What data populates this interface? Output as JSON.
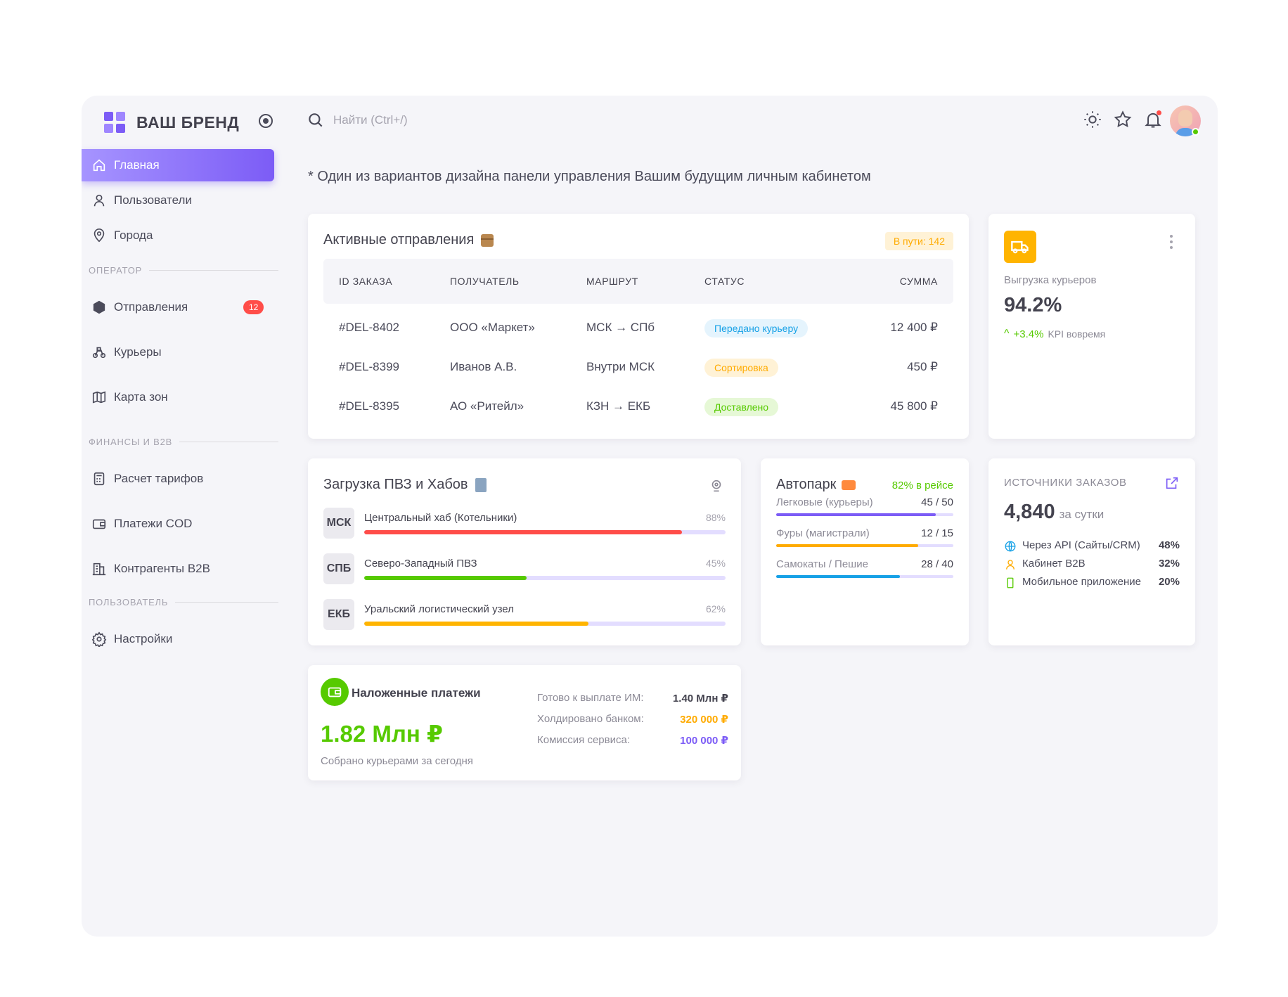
{
  "brand": {
    "name": "ВАШ БРЕНД"
  },
  "sidebar": {
    "items": [
      {
        "label": "Главная",
        "icon": "home-icon"
      },
      {
        "label": "Пользователи",
        "icon": "user-icon"
      },
      {
        "label": "Города",
        "icon": "location-icon"
      }
    ],
    "section_operator": "ОПЕРАТОР",
    "operator_items": [
      {
        "label": "Отправления",
        "icon": "box-icon",
        "badge": "12"
      },
      {
        "label": "Курьеры",
        "icon": "bike-icon"
      },
      {
        "label": "Карта зон",
        "icon": "map-icon"
      }
    ],
    "section_finance": "ФИНАНСЫ И B2B",
    "finance_items": [
      {
        "label": "Расчет тарифов",
        "icon": "calculator-icon"
      },
      {
        "label": "Платежи COD",
        "icon": "wallet-icon"
      },
      {
        "label": "Контрагенты B2B",
        "icon": "building-icon"
      }
    ],
    "section_user": "ПОЛЬЗОВАТЕЛЬ",
    "user_items": [
      {
        "label": "Настройки",
        "icon": "settings-icon"
      }
    ]
  },
  "header": {
    "search_placeholder": "Найти (Ctrl+/)",
    "icons": [
      "sun-icon",
      "star-icon",
      "bell-icon"
    ]
  },
  "note": "* Один из вариантов дизайна панели управления Вашим будущим личным кабинетом",
  "shipments": {
    "title": "Активные отправления",
    "pill": "В пути: 142",
    "columns": [
      "ID ЗАКАЗА",
      "ПОЛУЧАТЕЛЬ",
      "МАРШРУТ",
      "СТАТУС",
      "СУММА"
    ],
    "rows": [
      {
        "id": "#DEL-8402",
        "recipient": "ООО «Маркет»",
        "route": "МСК → СПб",
        "status": "Передано курьеру",
        "sum": "12 400 ₽"
      },
      {
        "id": "#DEL-8399",
        "recipient": "Иванов А.В.",
        "route": "Внутри МСК",
        "status": "Сортировка",
        "sum": "450 ₽"
      },
      {
        "id": "#DEL-8395",
        "recipient": "АО «Ритейл»",
        "route": "КЗН → ЕКБ",
        "status": "Доставлено",
        "sum": "45 800 ₽"
      }
    ]
  },
  "courier": {
    "label": "Выгрузка курьеров",
    "value": "94.2%",
    "trend": "+3.4%",
    "trend_note": "KPI вовремя"
  },
  "hubs": {
    "title": "Загрузка ПВЗ и Хабов",
    "rows": [
      {
        "code": "МСК",
        "name": "Центральный хаб (Котельники)",
        "pct": "88%",
        "fraction": 0.88,
        "color": "#ff4d49"
      },
      {
        "code": "СПБ",
        "name": "Северо-Западный ПВЗ",
        "pct": "45%",
        "fraction": 0.45,
        "color": "#56ca00"
      },
      {
        "code": "ЕКБ",
        "name": "Уральский логистический узел",
        "pct": "62%",
        "fraction": 0.62,
        "color": "#ffb400"
      }
    ]
  },
  "fleet": {
    "title": "Автопарк",
    "trip": "82% в рейсе",
    "rows": [
      {
        "name": "Легковые (курьеры)",
        "count": "45 / 50",
        "fraction": 0.9,
        "color": "#7c5cf6"
      },
      {
        "name": "Фуры (магистрали)",
        "count": "12 / 15",
        "fraction": 0.8,
        "color": "#ffab00"
      },
      {
        "name": "Самокаты / Пешие",
        "count": "28 / 40",
        "fraction": 0.7,
        "color": "#16a1e6"
      }
    ]
  },
  "sources": {
    "title": "ИСТОЧНИКИ ЗАКАЗОВ",
    "total": "4,840",
    "unit": "за сутки",
    "rows": [
      {
        "name": "Через API (Сайты/CRM)",
        "pct": "48%",
        "color": "#16a1e6",
        "icon": "globe-icon"
      },
      {
        "name": "Кабинет B2B",
        "pct": "32%",
        "color": "#ffab00",
        "icon": "user-icon"
      },
      {
        "name": "Мобильное приложение",
        "pct": "20%",
        "color": "#56ca00",
        "icon": "phone-icon"
      }
    ]
  },
  "cod": {
    "title": "Наложенные платежи",
    "amount": "1.82 Млн ₽",
    "sub": "Собрано курьерами за сегодня",
    "rows": [
      {
        "k": "Готово к выплате ИМ:",
        "v": "1.40 Млн ₽",
        "color": "#44434f"
      },
      {
        "k": "Холдировано банком:",
        "v": "320 000 ₽",
        "color": "#ffab00"
      },
      {
        "k": "Комиссия сервиса:",
        "v": "100 000 ₽",
        "color": "#7c5cf6"
      }
    ]
  }
}
